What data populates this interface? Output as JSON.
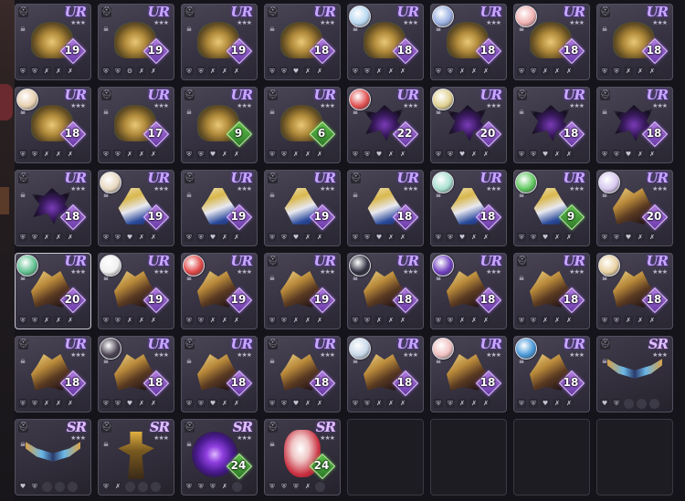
{
  "rarity_labels": {
    "ur": "UR",
    "sr": "SR"
  },
  "cards": [
    {
      "rarity": "ur",
      "art": "crown",
      "avatar": null,
      "level": "19",
      "lv_color": "purple",
      "stats": [
        "shield-icon",
        "shield-icon",
        "sword-icon",
        "sword-icon",
        "sword-icon"
      ]
    },
    {
      "rarity": "ur",
      "art": "crown",
      "avatar": null,
      "level": "19",
      "lv_color": "purple",
      "stats": [
        "shield-icon",
        "shield-icon",
        "gear-icon",
        "sword-icon",
        "sword-icon"
      ]
    },
    {
      "rarity": "ur",
      "art": "crown",
      "avatar": null,
      "level": "19",
      "lv_color": "purple",
      "stats": [
        "shield-icon",
        "shield-icon",
        "sword-icon",
        "sword-icon",
        "sword-icon"
      ]
    },
    {
      "rarity": "ur",
      "art": "crown",
      "avatar": null,
      "level": "18",
      "lv_color": "purple",
      "stats": [
        "shield-icon",
        "shield-icon",
        "heart-icon",
        "sword-icon",
        "sword-icon"
      ]
    },
    {
      "rarity": "ur",
      "art": "crown",
      "avatar": "#b8d8f0",
      "level": "18",
      "lv_color": "purple",
      "stats": [
        "shield-icon",
        "shield-icon",
        "sword-icon",
        "sword-icon",
        "sword-icon"
      ]
    },
    {
      "rarity": "ur",
      "art": "crown",
      "avatar": "#9ab0e0",
      "level": "18",
      "lv_color": "purple",
      "stats": [
        "shield-icon",
        "shield-icon",
        "sword-icon",
        "sword-icon",
        "sword-icon"
      ]
    },
    {
      "rarity": "ur",
      "art": "crown",
      "avatar": "#f0b0b0",
      "level": "18",
      "lv_color": "purple",
      "stats": [
        "shield-icon",
        "shield-icon",
        "sword-icon",
        "sword-icon",
        "sword-icon"
      ]
    },
    {
      "rarity": "ur",
      "art": "crown",
      "avatar": null,
      "level": "18",
      "lv_color": "purple",
      "stats": [
        "shield-icon",
        "shield-icon",
        "sword-icon",
        "sword-icon",
        "sword-icon"
      ]
    },
    {
      "rarity": "ur",
      "art": "crown",
      "avatar": "#e8d0b0",
      "level": "18",
      "lv_color": "purple",
      "stats": [
        "shield-icon",
        "shield-icon",
        "sword-icon",
        "sword-icon",
        "sword-icon"
      ]
    },
    {
      "rarity": "ur",
      "art": "crown",
      "avatar": null,
      "level": "17",
      "lv_color": "purple",
      "stats": [
        "shield-icon",
        "shield-icon",
        "sword-icon",
        "sword-icon",
        "sword-icon"
      ]
    },
    {
      "rarity": "ur",
      "art": "crown",
      "avatar": null,
      "level": "9",
      "lv_color": "green",
      "stats": [
        "shield-icon",
        "shield-icon",
        "heart-icon",
        "sword-icon",
        "sword-icon"
      ]
    },
    {
      "rarity": "ur",
      "art": "crown",
      "avatar": null,
      "level": "6",
      "lv_color": "green",
      "stats": [
        "shield-icon",
        "shield-icon",
        "sword-icon",
        "sword-icon",
        "sword-icon"
      ]
    },
    {
      "rarity": "ur",
      "art": "dark",
      "avatar": "#e05050",
      "level": "22",
      "lv_color": "purple",
      "stats": [
        "shield-icon",
        "shield-icon",
        "heart-icon",
        "sword-icon",
        "sword-icon"
      ]
    },
    {
      "rarity": "ur",
      "art": "dark",
      "avatar": "#e0d090",
      "level": "20",
      "lv_color": "purple",
      "stats": [
        "shield-icon",
        "shield-icon",
        "heart-icon",
        "sword-icon",
        "sword-icon"
      ]
    },
    {
      "rarity": "ur",
      "art": "dark",
      "avatar": null,
      "level": "18",
      "lv_color": "purple",
      "stats": [
        "shield-icon",
        "shield-icon",
        "heart-icon",
        "sword-icon",
        "sword-icon"
      ]
    },
    {
      "rarity": "ur",
      "art": "dark",
      "avatar": null,
      "level": "18",
      "lv_color": "purple",
      "stats": [
        "shield-icon",
        "shield-icon",
        "heart-icon",
        "sword-icon",
        "sword-icon"
      ]
    },
    {
      "rarity": "ur",
      "art": "dark",
      "avatar": null,
      "level": "18",
      "lv_color": "purple",
      "stats": [
        "shield-icon",
        "shield-icon",
        "sword-icon",
        "sword-icon",
        "sword-icon"
      ]
    },
    {
      "rarity": "ur",
      "art": "gold",
      "avatar": "#e8d8c0",
      "level": "19",
      "lv_color": "purple",
      "stats": [
        "shield-icon",
        "shield-icon",
        "heart-icon",
        "sword-icon",
        "sword-icon"
      ]
    },
    {
      "rarity": "ur",
      "art": "gold",
      "avatar": null,
      "level": "19",
      "lv_color": "purple",
      "stats": [
        "shield-icon",
        "shield-icon",
        "heart-icon",
        "sword-icon",
        "sword-icon"
      ]
    },
    {
      "rarity": "ur",
      "art": "gold",
      "avatar": null,
      "level": "19",
      "lv_color": "purple",
      "stats": [
        "shield-icon",
        "shield-icon",
        "heart-icon",
        "sword-icon",
        "sword-icon"
      ]
    },
    {
      "rarity": "ur",
      "art": "gold",
      "avatar": null,
      "level": "18",
      "lv_color": "purple",
      "stats": [
        "shield-icon",
        "shield-icon",
        "heart-icon",
        "sword-icon",
        "sword-icon"
      ]
    },
    {
      "rarity": "ur",
      "art": "gold",
      "avatar": "#a8e0d0",
      "level": "18",
      "lv_color": "purple",
      "stats": [
        "shield-icon",
        "shield-icon",
        "heart-icon",
        "sword-icon",
        "sword-icon"
      ]
    },
    {
      "rarity": "ur",
      "art": "gold",
      "avatar": "#60c860",
      "level": "9",
      "lv_color": "green",
      "stats": [
        "shield-icon",
        "shield-icon",
        "heart-icon",
        "sword-icon",
        "sword-icon"
      ]
    },
    {
      "rarity": "ur",
      "art": "claw",
      "avatar": "#d8c8f0",
      "level": "20",
      "lv_color": "purple",
      "stats": [
        "shield-icon",
        "shield-icon",
        "heart-icon",
        "sword-icon",
        "sword-icon"
      ]
    },
    {
      "rarity": "ur",
      "art": "claw",
      "avatar": "#60c090",
      "level": "20",
      "lv_color": "purple",
      "stats": [
        "shield-icon",
        "shield-icon",
        "sword-icon",
        "sword-icon",
        "sword-icon"
      ],
      "selected": true
    },
    {
      "rarity": "ur",
      "art": "claw",
      "avatar": "#f0f0f0",
      "level": "19",
      "lv_color": "purple",
      "stats": [
        "shield-icon",
        "shield-icon",
        "sword-icon",
        "sword-icon",
        "sword-icon"
      ]
    },
    {
      "rarity": "ur",
      "art": "claw",
      "avatar": "#e04848",
      "level": "19",
      "lv_color": "purple",
      "stats": [
        "shield-icon",
        "shield-icon",
        "sword-icon",
        "sword-icon",
        "sword-icon"
      ]
    },
    {
      "rarity": "ur",
      "art": "claw",
      "avatar": null,
      "level": "19",
      "lv_color": "purple",
      "stats": [
        "shield-icon",
        "shield-icon",
        "sword-icon",
        "sword-icon",
        "sword-icon"
      ]
    },
    {
      "rarity": "ur",
      "art": "claw",
      "avatar": "#303040",
      "level": "18",
      "lv_color": "purple",
      "stats": [
        "shield-icon",
        "shield-icon",
        "sword-icon",
        "sword-icon",
        "sword-icon"
      ]
    },
    {
      "rarity": "ur",
      "art": "claw",
      "avatar": "#7040c0",
      "level": "18",
      "lv_color": "purple",
      "stats": [
        "shield-icon",
        "shield-icon",
        "sword-icon",
        "sword-icon",
        "sword-icon"
      ]
    },
    {
      "rarity": "ur",
      "art": "claw",
      "avatar": null,
      "level": "18",
      "lv_color": "purple",
      "stats": [
        "shield-icon",
        "shield-icon",
        "sword-icon",
        "sword-icon",
        "sword-icon"
      ]
    },
    {
      "rarity": "ur",
      "art": "claw",
      "avatar": "#e8d0a0",
      "level": "18",
      "lv_color": "purple",
      "stats": [
        "shield-icon",
        "shield-icon",
        "sword-icon",
        "sword-icon",
        "sword-icon"
      ]
    },
    {
      "rarity": "ur",
      "art": "claw",
      "avatar": null,
      "level": "18",
      "lv_color": "purple",
      "stats": [
        "shield-icon",
        "shield-icon",
        "sword-icon",
        "sword-icon",
        "sword-icon"
      ]
    },
    {
      "rarity": "ur",
      "art": "claw",
      "avatar": "#484050",
      "level": "18",
      "lv_color": "purple",
      "stats": [
        "shield-icon",
        "shield-icon",
        "heart-icon",
        "sword-icon",
        "sword-icon"
      ]
    },
    {
      "rarity": "ur",
      "art": "claw",
      "avatar": null,
      "level": "18",
      "lv_color": "purple",
      "stats": [
        "shield-icon",
        "shield-icon",
        "heart-icon",
        "sword-icon",
        "sword-icon"
      ]
    },
    {
      "rarity": "ur",
      "art": "claw",
      "avatar": null,
      "level": "18",
      "lv_color": "purple",
      "stats": [
        "shield-icon",
        "shield-icon",
        "heart-icon",
        "sword-icon",
        "sword-icon"
      ]
    },
    {
      "rarity": "ur",
      "art": "claw",
      "avatar": "#c8d8e8",
      "level": "18",
      "lv_color": "purple",
      "stats": [
        "shield-icon",
        "shield-icon",
        "sword-icon",
        "sword-icon",
        "sword-icon"
      ]
    },
    {
      "rarity": "ur",
      "art": "claw",
      "avatar": "#f0c0c0",
      "level": "18",
      "lv_color": "purple",
      "stats": [
        "shield-icon",
        "shield-icon",
        "sword-icon",
        "sword-icon",
        "sword-icon"
      ]
    },
    {
      "rarity": "ur",
      "art": "claw",
      "avatar": "#4898d8",
      "level": "18",
      "lv_color": "purple",
      "stats": [
        "shield-icon",
        "shield-icon",
        "heart-icon",
        "sword-icon",
        "sword-icon"
      ]
    },
    {
      "rarity": "sr",
      "art": "bow",
      "avatar": null,
      "level": null,
      "lv_color": null,
      "stats": [
        "heart-icon",
        "shield-icon",
        "dot",
        "dot",
        "dot"
      ]
    },
    {
      "rarity": "sr",
      "art": "bow",
      "avatar": null,
      "level": null,
      "lv_color": null,
      "stats": [
        "heart-icon",
        "shield-icon",
        "dot",
        "dot",
        "dot"
      ]
    },
    {
      "rarity": "sr",
      "art": "totem",
      "avatar": null,
      "level": null,
      "lv_color": null,
      "stats": [
        "shield-icon",
        "sword-icon",
        "dot",
        "dot",
        "dot"
      ]
    },
    {
      "rarity": "sr",
      "art": "orb",
      "avatar": null,
      "level": "24",
      "lv_color": "green",
      "stats": [
        "shield-icon",
        "shield-icon",
        "shield-icon",
        "sword-icon",
        "dot"
      ]
    },
    {
      "rarity": "sr",
      "art": "potion",
      "avatar": null,
      "level": "24",
      "lv_color": "green",
      "stats": [
        "shield-icon",
        "shield-icon",
        "shield-icon",
        "sword-icon",
        "dot"
      ]
    },
    {
      "empty": true
    },
    {
      "empty": true
    },
    {
      "empty": true
    },
    {
      "empty": true
    }
  ]
}
